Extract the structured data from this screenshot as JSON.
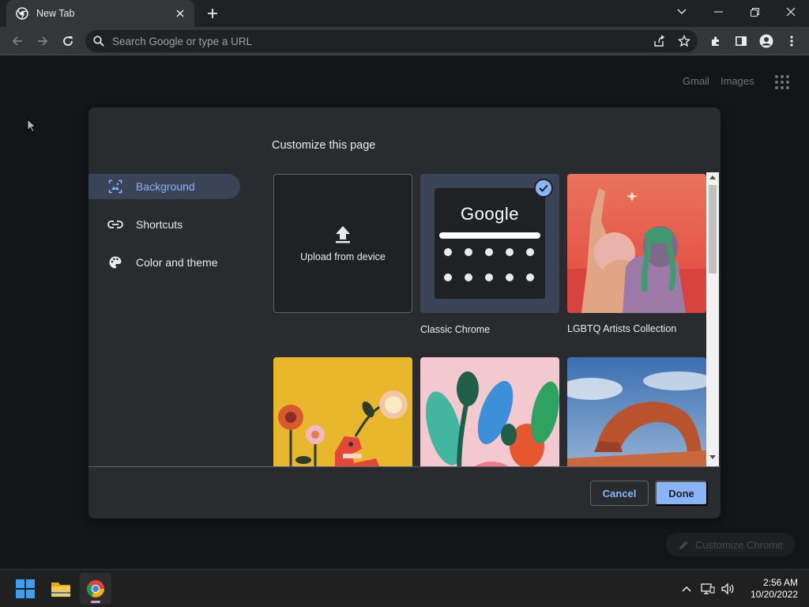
{
  "browser": {
    "tab_title": "New Tab",
    "omnibox_placeholder": "Search Google or type a URL"
  },
  "page": {
    "gmail_label": "Gmail",
    "images_label": "Images",
    "customize_chrome_label": "Customize Chrome"
  },
  "dialog": {
    "title": "Customize this page",
    "nav": [
      {
        "label": "Background",
        "icon": "image-icon",
        "active": true
      },
      {
        "label": "Shortcuts",
        "icon": "link-icon",
        "active": false
      },
      {
        "label": "Color and theme",
        "icon": "palette-icon",
        "active": false
      }
    ],
    "tiles": {
      "upload_label": "Upload from device",
      "classic_google_text": "Google",
      "classic_label": "Classic Chrome",
      "lgbtq_label": "LGBTQ Artists Collection"
    },
    "cancel_label": "Cancel",
    "done_label": "Done"
  },
  "taskbar": {
    "time": "2:56 AM",
    "date": "10/20/2022"
  },
  "colors": {
    "accent": "#8ab4f8",
    "dialog_bg": "#2a2b2f",
    "active_nav_bg": "#394457"
  }
}
